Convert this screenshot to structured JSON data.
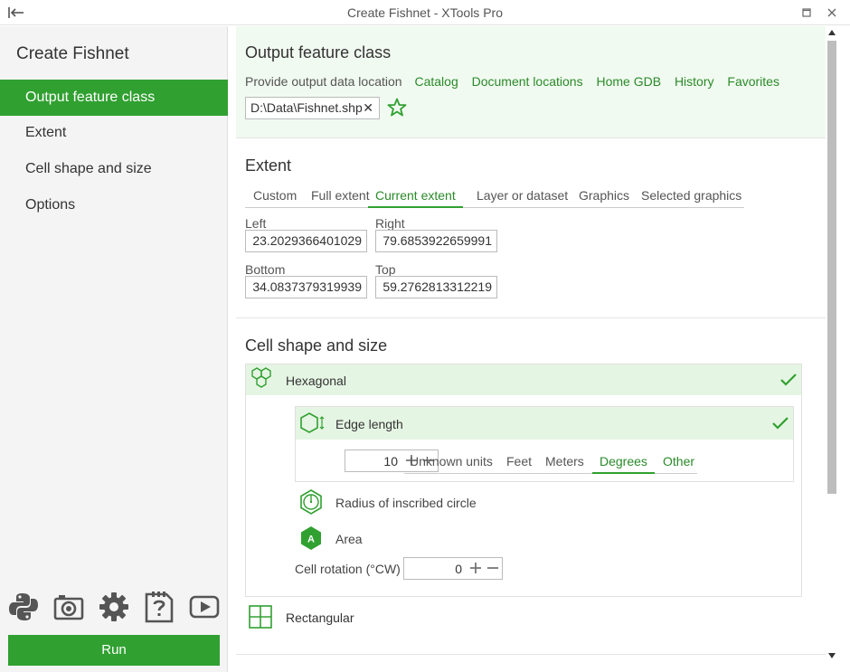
{
  "window": {
    "title": "Create Fishnet - XTools Pro"
  },
  "sidebar": {
    "title": "Create Fishnet",
    "items": [
      {
        "label": "Output feature class"
      },
      {
        "label": "Extent"
      },
      {
        "label": "Cell shape and size"
      },
      {
        "label": "Options"
      }
    ],
    "tool_icons": [
      "python-icon",
      "camera-icon",
      "gear-icon",
      "help-document-icon",
      "video-icon"
    ],
    "run_label": "Run"
  },
  "output": {
    "title": "Output feature class",
    "location_label": "Provide output data location",
    "links": [
      "Catalog",
      "Document locations",
      "Home GDB",
      "History",
      "Favorites"
    ],
    "path_value": "D:\\Data\\Fishnet.shp"
  },
  "extent": {
    "title": "Extent",
    "tabs": [
      "Custom",
      "Full extent",
      "Current extent",
      "Layer or dataset",
      "Graphics",
      "Selected graphics"
    ],
    "active_tab": "Current extent",
    "left_label": "Left",
    "left_value": "23.2029366401029",
    "right_label": "Right",
    "right_value": "79.6853922659991",
    "bottom_label": "Bottom",
    "bottom_value": "34.0837379319939",
    "top_label": "Top",
    "top_value": "59.2762813312219"
  },
  "cell": {
    "title": "Cell shape and size",
    "hexagonal_label": "Hexagonal",
    "edge_length_label": "Edge length",
    "edge_value": "10",
    "units": [
      "Unknown units",
      "Feet",
      "Meters",
      "Degrees",
      "Other"
    ],
    "active_unit": "Degrees",
    "radius_label": "Radius of inscribed circle",
    "area_label": "Area",
    "area_icon_letter": "A",
    "rotation_label": "Cell rotation (°CW)",
    "rotation_value": "0",
    "rectangular_label": "Rectangular"
  },
  "colors": {
    "accent": "#30a030",
    "link": "#2a8a2a",
    "selected_bg": "#e5f5e3",
    "output_bg": "#f1faf0"
  }
}
